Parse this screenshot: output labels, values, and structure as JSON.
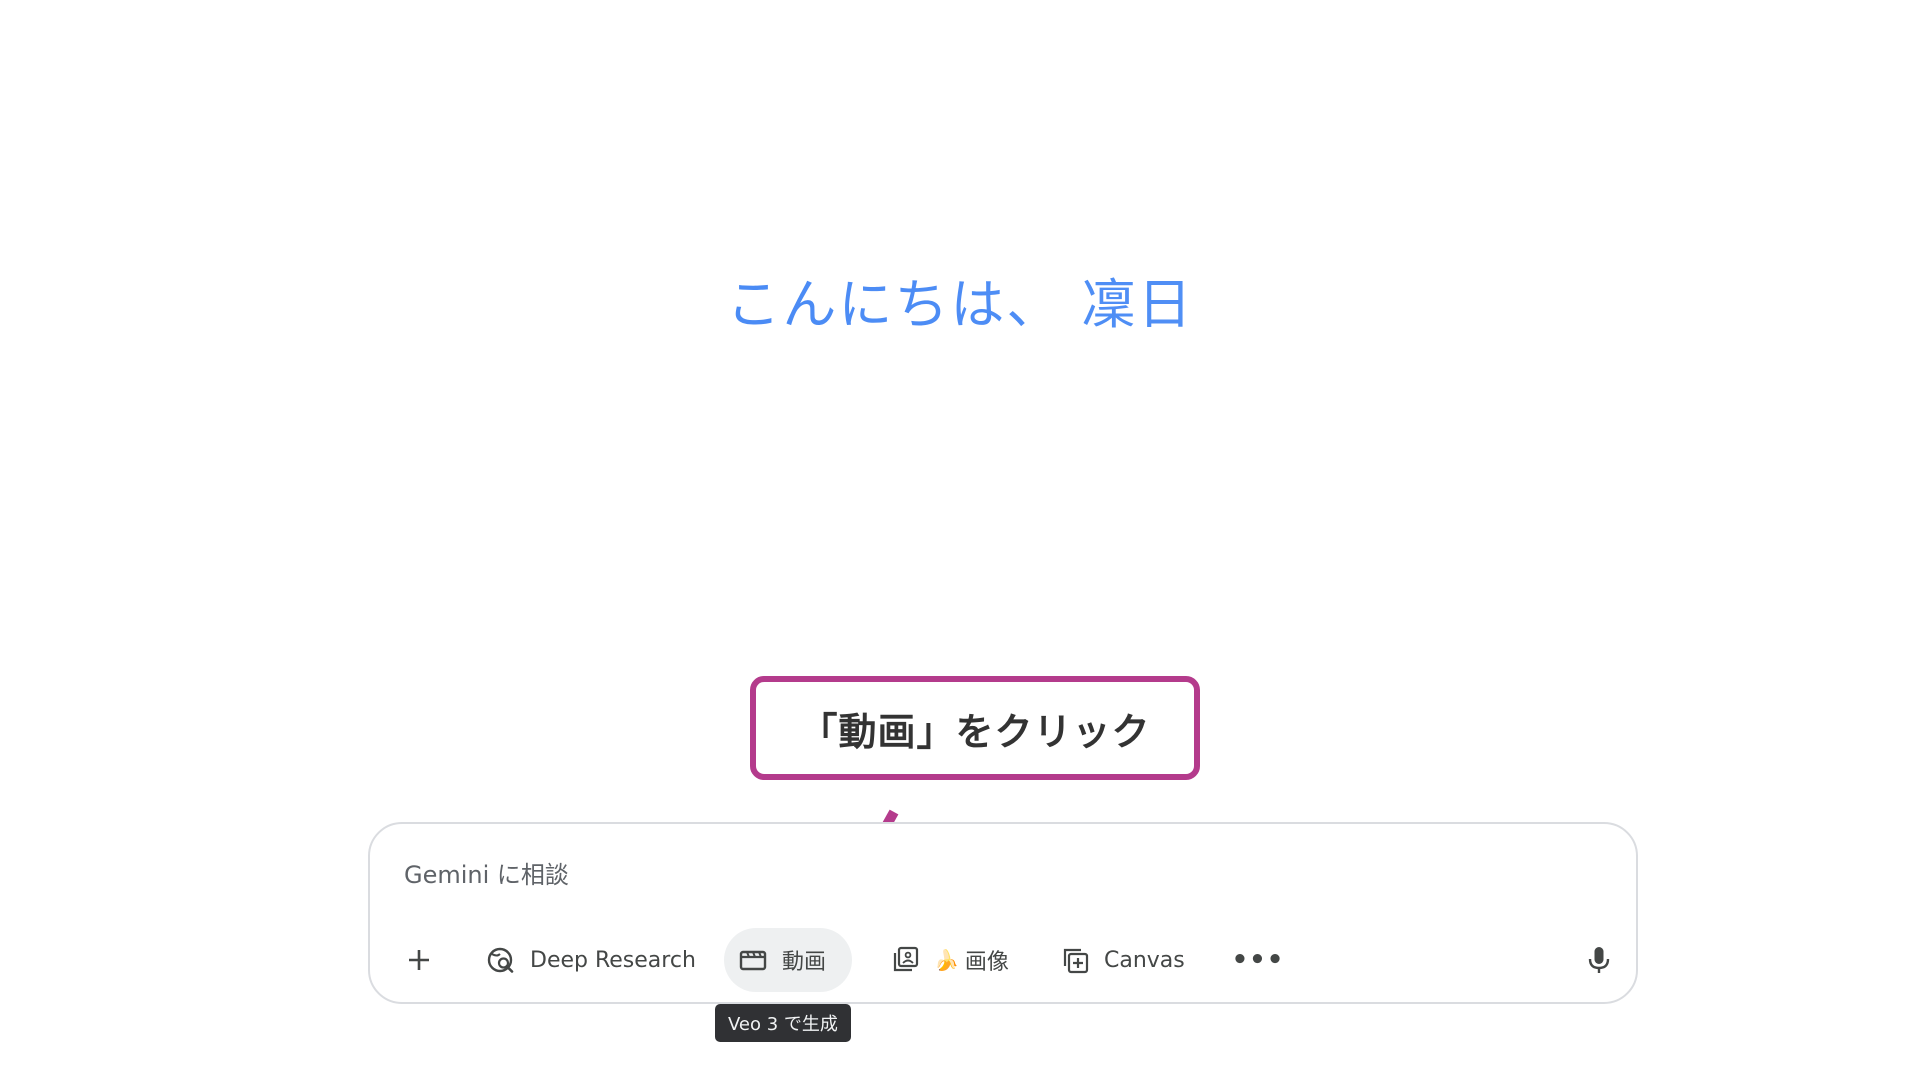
{
  "greeting": "こんにちは、 凜日",
  "annotation": {
    "callout_text": "「動画」をクリック",
    "color": "#b43b8c"
  },
  "composer": {
    "placeholder": "Gemini に相談",
    "tools": {
      "add": {
        "icon": "plus-icon"
      },
      "deep_research": {
        "label": "Deep Research",
        "icon": "deep-research-icon"
      },
      "video": {
        "label": "動画",
        "icon": "clapperboard-icon",
        "tooltip": "Veo 3 で生成"
      },
      "image": {
        "emoji": "🍌",
        "label": "画像",
        "icon": "image-gallery-icon"
      },
      "canvas": {
        "label": "Canvas",
        "icon": "canvas-icon"
      },
      "more": {
        "label": "•••",
        "icon": "more-icon"
      },
      "mic": {
        "icon": "microphone-icon"
      }
    }
  },
  "colors": {
    "greeting": "#4285f4",
    "accent_annotation": "#b43b8c",
    "tooltip_bg": "#303134"
  }
}
